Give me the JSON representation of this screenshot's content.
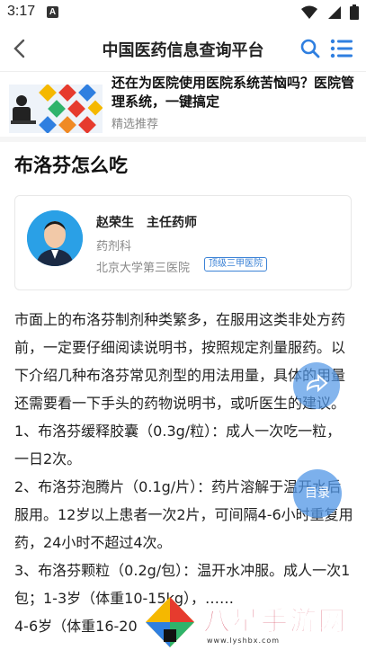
{
  "status_bar": {
    "time": "3:17",
    "notification_letter": "A"
  },
  "header": {
    "title": "中国医药信息查询平台"
  },
  "ad": {
    "title": "还在为医院使用医院系统苦恼吗？医院管理系统，一键搞定",
    "subtitle": "精选推荐"
  },
  "article": {
    "title": "布洛芬怎么吃"
  },
  "doctor": {
    "name_title": "赵荣生　主任药师",
    "department": "药剂科",
    "hospital": "北京大学第三医院",
    "hospital_level": "顶级三甲医院"
  },
  "content": {
    "paragraphs": [
      "市面上的布洛芬制剂种类繁多，在服用这类非处方药前，一定要仔细阅读说明书，按照规定剂量服药。以下介绍几种布洛芬常见剂型的用法用量，具体的用量还需要看一下手头的药物说明书，或听医生的建议。",
      "1、布洛芬缓释胶囊（0.3g/粒）：成人一次吃一粒，一日2次。",
      "2、布洛芬泡腾片（0.1g/片）：药片溶解于温开水后服用。12岁以上患者一次2片，可间隔4-6小时重复用药，24小时不超过4次。",
      "3、布洛芬颗粒（0.2g/包）：温开水冲服。成人一次1包；1-3岁（体重10-15kg），……",
      "4-6岁（体重16-20"
    ]
  },
  "floating": {
    "toc_label": "目录"
  },
  "watermark": {
    "text": "八星手游网",
    "url": "www.lyshbx.com"
  },
  "colors": {
    "accent": "#2f7fe0",
    "badge": "#3b82d6",
    "watermark": "#c8102e"
  }
}
